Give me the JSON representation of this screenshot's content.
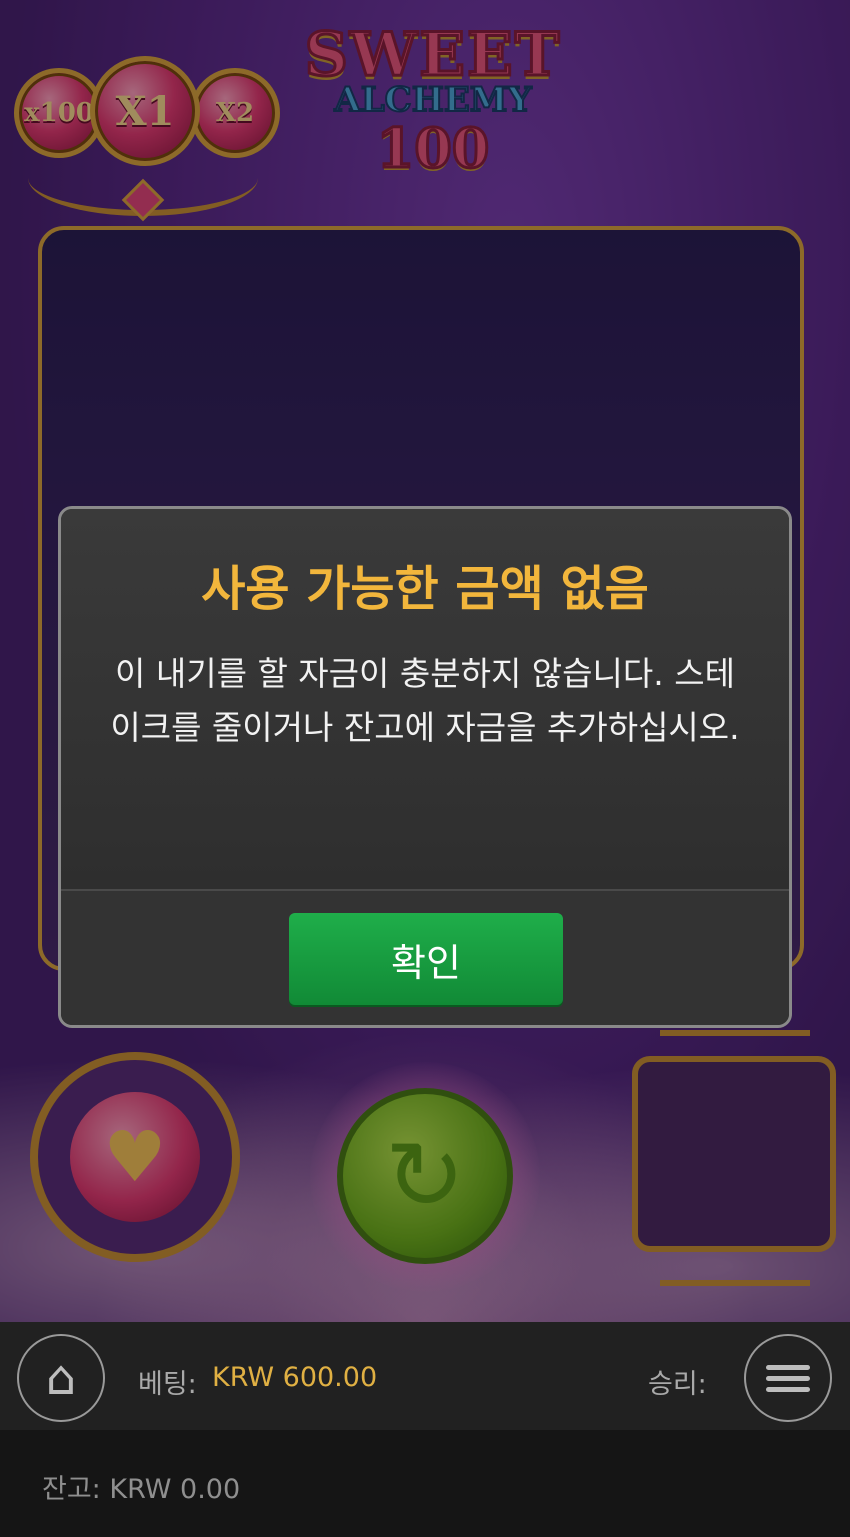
{
  "game": {
    "logo": {
      "line1": "SWEET",
      "line2": "ALCHEMY",
      "line3": "100"
    },
    "multipliers": [
      "x100",
      "X1",
      "X2"
    ]
  },
  "dialog": {
    "title": "사용 가능한 금액 없음",
    "message": "이 내기를 할 자금이 충분하지 않습니다. 스테이크를 줄이거나 잔고에 자금을 추가하십시오.",
    "ok_label": "확인"
  },
  "status": {
    "bet_label": "베팅:",
    "bet_value": "KRW 600.00",
    "win_label": "승리:",
    "balance": "잔고: KRW 0.00"
  },
  "icons": {
    "home": "home-icon",
    "menu": "menu-icon",
    "spin": "refresh-icon",
    "special": "heart-icon"
  },
  "colors": {
    "title_accent": "#f2b63c",
    "ok_button": "#1fae4a",
    "bet_value": "#e0b043",
    "frame_gold": "#d9a440"
  }
}
